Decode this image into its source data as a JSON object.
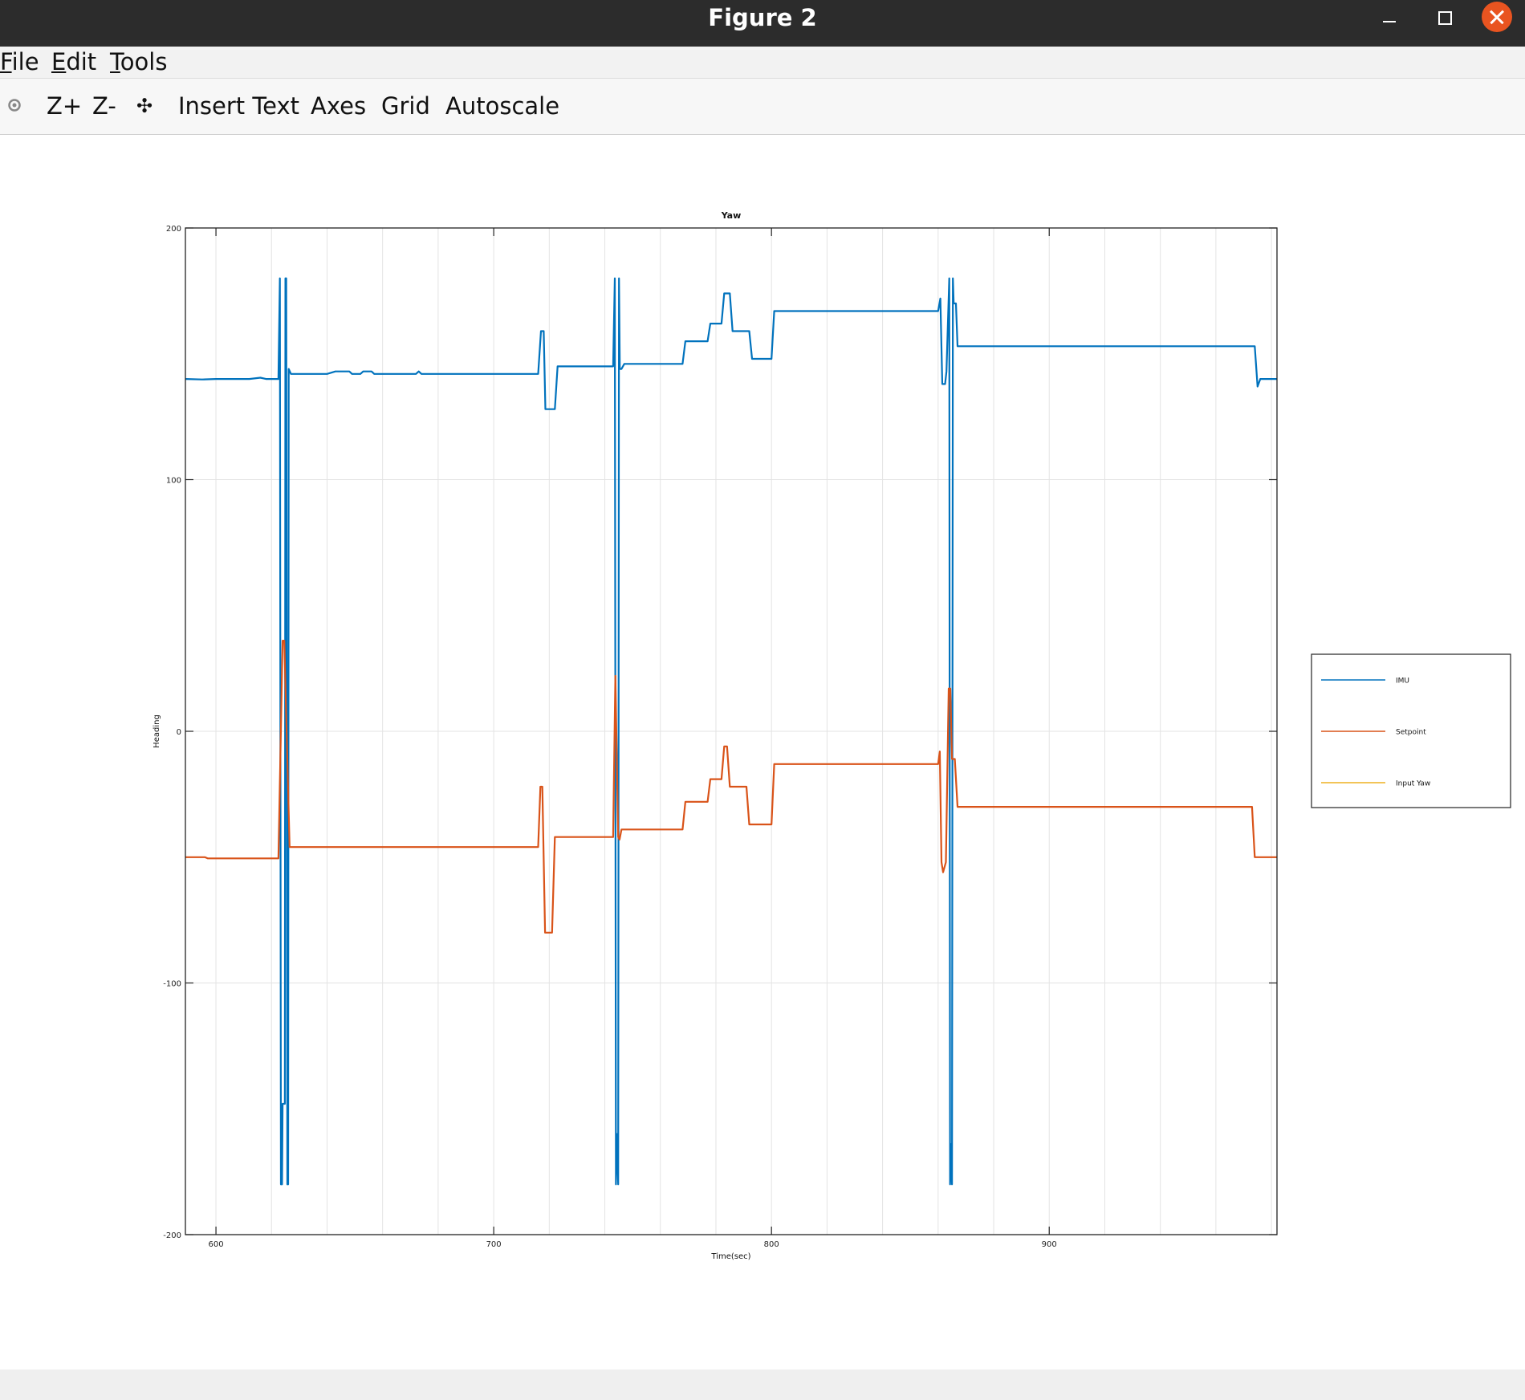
{
  "window": {
    "title": "Figure 2",
    "close_color": "#e95420"
  },
  "menu": {
    "file": {
      "underline": "F",
      "rest": "ile"
    },
    "edit": {
      "underline": "E",
      "rest": "dit"
    },
    "tools": {
      "underline": "T",
      "rest": "ools"
    }
  },
  "toolbar": {
    "rotate_icon": "rotate-icon",
    "zoom_in": "Z+",
    "zoom_out": "Z-",
    "pan_icon": "pan-icon",
    "pan_glyph": "✣",
    "insert_text": "Insert Text",
    "axes": "Axes",
    "grid": "Grid",
    "autoscale": "Autoscale"
  },
  "chart_data": {
    "type": "line",
    "title": "Yaw",
    "xlabel": "Time(sec)",
    "ylabel": "Heading",
    "xlim": [
      589,
      982
    ],
    "ylim": [
      -200,
      200
    ],
    "xticks": [
      600,
      700,
      800,
      900
    ],
    "yticks": [
      200,
      100,
      0,
      -100,
      -200
    ],
    "grid": true,
    "minor_grid_x_step": 20,
    "legend_position": "right-outside",
    "series": [
      {
        "name": "IMU",
        "color": "#0072bd",
        "points": [
          [
            589,
            140
          ],
          [
            595,
            139.8
          ],
          [
            600,
            140
          ],
          [
            612,
            140
          ],
          [
            616,
            140.5
          ],
          [
            618,
            140
          ],
          [
            622.5,
            140
          ],
          [
            623,
            180
          ],
          [
            623.4,
            -180
          ],
          [
            623.8,
            -180
          ],
          [
            624,
            -148
          ],
          [
            624.8,
            -148
          ],
          [
            625,
            180
          ],
          [
            625.3,
            180
          ],
          [
            625.7,
            -180
          ],
          [
            626,
            -180
          ],
          [
            626.2,
            144
          ],
          [
            627,
            142
          ],
          [
            640,
            142
          ],
          [
            643,
            143
          ],
          [
            648,
            143
          ],
          [
            649,
            142
          ],
          [
            652,
            142
          ],
          [
            653,
            143
          ],
          [
            656,
            143
          ],
          [
            657,
            142
          ],
          [
            672,
            142
          ],
          [
            673,
            143
          ],
          [
            674,
            142
          ],
          [
            700,
            142
          ],
          [
            716,
            142
          ],
          [
            717,
            159
          ],
          [
            718,
            159
          ],
          [
            718.6,
            128
          ],
          [
            722,
            128
          ],
          [
            723,
            145
          ],
          [
            735,
            145
          ],
          [
            743,
            145
          ],
          [
            743.6,
            180
          ],
          [
            744,
            -180
          ],
          [
            744.4,
            -160
          ],
          [
            744.8,
            -180
          ],
          [
            745.1,
            180
          ],
          [
            745.4,
            144
          ],
          [
            746,
            144
          ],
          [
            747,
            146
          ],
          [
            768,
            146
          ],
          [
            769,
            155
          ],
          [
            777,
            155
          ],
          [
            778,
            162
          ],
          [
            782,
            162
          ],
          [
            783,
            174
          ],
          [
            785,
            174
          ],
          [
            786,
            159
          ],
          [
            792,
            159
          ],
          [
            793,
            148
          ],
          [
            800,
            148
          ],
          [
            801,
            167
          ],
          [
            860,
            167
          ],
          [
            860.8,
            172
          ],
          [
            861.5,
            138
          ],
          [
            862.5,
            138
          ],
          [
            863,
            143
          ],
          [
            864,
            180
          ],
          [
            864.3,
            -180
          ],
          [
            864.6,
            -164
          ],
          [
            865,
            -180
          ],
          [
            865.3,
            180
          ],
          [
            865.6,
            170
          ],
          [
            866.4,
            170
          ],
          [
            867,
            153
          ],
          [
            900,
            153
          ],
          [
            974,
            153
          ],
          [
            975,
            137
          ],
          [
            976,
            140
          ],
          [
            982,
            140
          ]
        ]
      },
      {
        "name": "Setpoint",
        "color": "#d95319",
        "points": [
          [
            589,
            -50
          ],
          [
            596,
            -50
          ],
          [
            597,
            -50.5
          ],
          [
            622.5,
            -50.5
          ],
          [
            624,
            36
          ],
          [
            624.6,
            36
          ],
          [
            626.5,
            -46
          ],
          [
            700,
            -46
          ],
          [
            716,
            -46
          ],
          [
            716.8,
            -22
          ],
          [
            717.5,
            -22
          ],
          [
            718.5,
            -80
          ],
          [
            721,
            -80
          ],
          [
            722,
            -42
          ],
          [
            743,
            -42
          ],
          [
            743.8,
            22
          ],
          [
            744.8,
            -42
          ],
          [
            745.3,
            -43
          ],
          [
            746,
            -39
          ],
          [
            768,
            -39
          ],
          [
            769,
            -28
          ],
          [
            777,
            -28
          ],
          [
            778,
            -19
          ],
          [
            782,
            -19
          ],
          [
            783,
            -6
          ],
          [
            784,
            -6
          ],
          [
            785,
            -22
          ],
          [
            791,
            -22
          ],
          [
            792,
            -37
          ],
          [
            800,
            -37
          ],
          [
            801,
            -13
          ],
          [
            860,
            -13
          ],
          [
            860.6,
            -8
          ],
          [
            861.2,
            -52
          ],
          [
            861.8,
            -56
          ],
          [
            862.8,
            -52
          ],
          [
            863.8,
            17
          ],
          [
            864.4,
            17
          ],
          [
            865,
            -11
          ],
          [
            866,
            -11
          ],
          [
            867,
            -30
          ],
          [
            900,
            -30
          ],
          [
            973,
            -30
          ],
          [
            974,
            -50
          ],
          [
            982,
            -50
          ]
        ]
      },
      {
        "name": "Input Yaw",
        "color": "#edb120",
        "points": []
      }
    ]
  }
}
